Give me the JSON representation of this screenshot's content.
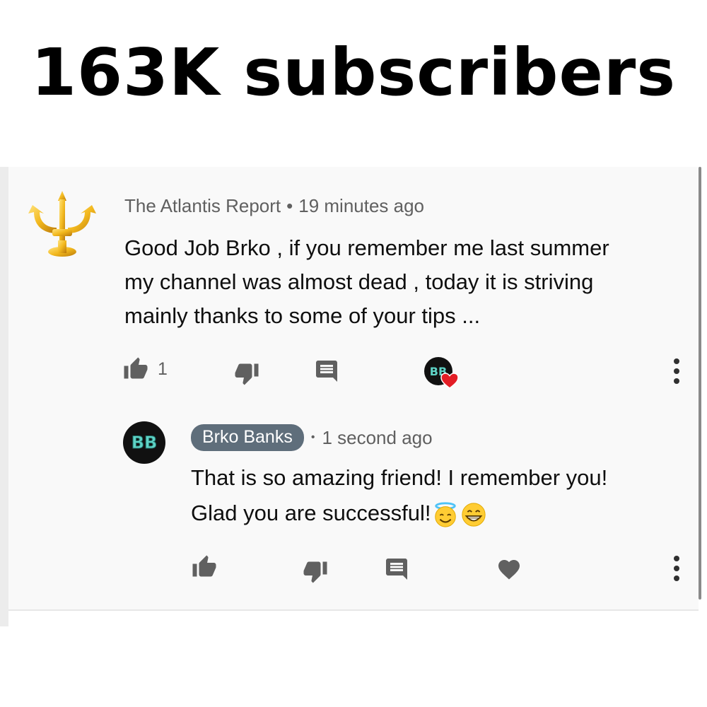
{
  "headline": "163K subscribers",
  "comment": {
    "author": "The Atlantis Report",
    "separator": "•",
    "time": "19 minutes ago",
    "text_lines": [
      "Good Job Brko , if you remember me last summer",
      "my channel was almost dead , today it is striving",
      "mainly thanks to some of your tips ..."
    ],
    "like_count": "1",
    "avatar_icon": "trident-icon",
    "creator_heart_icon": "creator-heart-icon"
  },
  "reply": {
    "author": "Brko Banks",
    "separator": "•",
    "time": "1 second ago",
    "text_line_1": "That is so amazing friend! I remember you!",
    "text_line_2": "Glad you are successful!",
    "emojis": [
      "smiling-face-with-halo",
      "grinning-face-with-smiling-eyes"
    ],
    "avatar_letters": "BB"
  },
  "colors": {
    "panel_bg": "#f9f9f9",
    "meta_gray": "#606060",
    "chip_bg": "#5f6e7b",
    "heart_red": "#e31d25",
    "avatar_teal": "#5fd3c6"
  }
}
